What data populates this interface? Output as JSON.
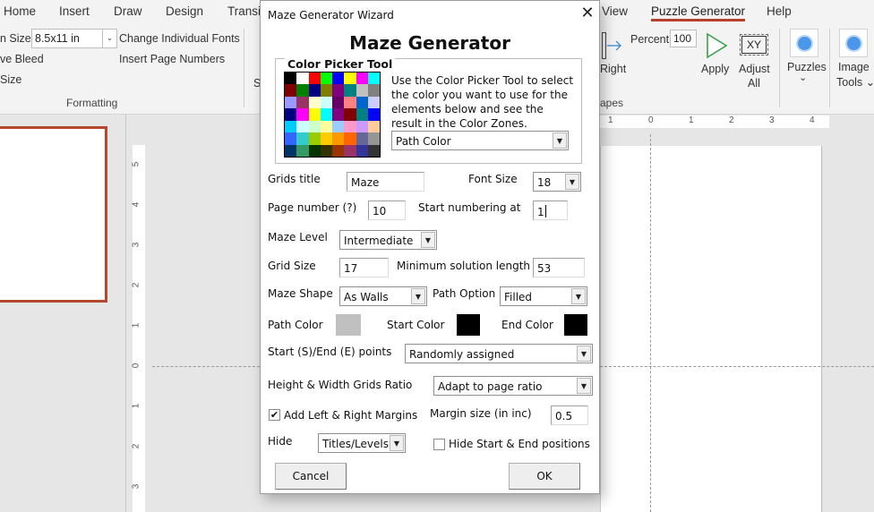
{
  "ribbon": {
    "tabs": [
      {
        "label": "Home"
      },
      {
        "label": "Insert"
      },
      {
        "label": "Draw"
      },
      {
        "label": "Design"
      },
      {
        "label": "Transit"
      },
      {
        "label": "View"
      },
      {
        "label": "Puzzle Generator",
        "active": true
      },
      {
        "label": "Help"
      }
    ],
    "formatting": {
      "size_label": "n Size",
      "size_value": "8.5x11 in",
      "bleed_label": "ve Bleed",
      "size2_label": "Size",
      "change_fonts": "Change Individual Fonts",
      "insert_page_numbers": "Insert Page Numbers",
      "group_label": "Formatting",
      "partial_group_letter": "S"
    },
    "shapes": {
      "right_label": "Right",
      "group_label": "apes",
      "percent_label": "Percent",
      "percent_value": "100",
      "apply_label": "Apply",
      "adjust_label_1": "Adjust",
      "adjust_label_2": "All",
      "xy_icon_text": "XY"
    },
    "puzzles": {
      "label": "Puzzles",
      "chevron": "⌄"
    },
    "image_tools": {
      "label_1": "Image",
      "label_2": "Tools ⌄"
    },
    "accent_color": "#b5412c"
  },
  "rulers": {
    "horizontal": [
      "1",
      "0",
      "1",
      "2",
      "3",
      "4"
    ],
    "vertical": [
      "5",
      "4",
      "3",
      "2",
      "1",
      "0",
      "1",
      "2",
      "3"
    ]
  },
  "dialog": {
    "window_title": "Maze Generator Wizard",
    "heading": "Maze Generator",
    "color_picker": {
      "legend": "Color Picker Tool",
      "help_text": "Use the Color Picker Tool to select the color you want to use for the elements below and see the result in the Color Zones.",
      "target_value": "Path Color",
      "palette": [
        "#000000",
        "#ffffff",
        "#ff0000",
        "#00ff00",
        "#0000ff",
        "#ffff00",
        "#ff00ff",
        "#00ffff",
        "#800000",
        "#008000",
        "#000080",
        "#808000",
        "#800080",
        "#008080",
        "#c0c0c0",
        "#808080",
        "#9999ff",
        "#993366",
        "#ffffcc",
        "#ccffff",
        "#660066",
        "#ff8080",
        "#0066cc",
        "#ccccff",
        "#000080",
        "#ff00ff",
        "#ffff00",
        "#00ffff",
        "#800080",
        "#800000",
        "#008080",
        "#0000ff",
        "#00ccff",
        "#ccffff",
        "#ccffcc",
        "#ffff99",
        "#99ccff",
        "#ff99cc",
        "#cc99ff",
        "#ffcc99",
        "#3366ff",
        "#33cccc",
        "#99cc00",
        "#ffcc00",
        "#ff9900",
        "#ff6600",
        "#666699",
        "#969696",
        "#003366",
        "#339966",
        "#003300",
        "#333300",
        "#993300",
        "#993366",
        "#333399",
        "#333333"
      ]
    },
    "fields": {
      "grids_title_label": "Grids title",
      "grids_title_value": "Maze",
      "font_size_label": "Font Size",
      "font_size_value": "18",
      "page_number_label": "Page number (?)",
      "page_number_value": "10",
      "start_numbering_label": "Start numbering at",
      "start_numbering_value": "1",
      "maze_level_label": "Maze Level",
      "maze_level_value": "Intermediate",
      "grid_size_label": "Grid Size",
      "grid_size_value": "17",
      "min_solution_label": "Minimum solution length",
      "min_solution_value": "53",
      "maze_shape_label": "Maze Shape",
      "maze_shape_value": "As Walls",
      "path_option_label": "Path Option",
      "path_option_value": "Filled",
      "path_color_label": "Path Color",
      "path_color": "#c0c0c0",
      "start_color_label": "Start Color",
      "start_color": "#000000",
      "end_color_label": "End Color",
      "end_color": "#000000",
      "se_points_label": "Start (S)/End (E) points",
      "se_points_value": "Randomly assigned",
      "ratio_label": "Height & Width Grids Ratio",
      "ratio_value": "Adapt to page ratio",
      "margins_label": "Add Left & Right Margins",
      "margins_checked": true,
      "margin_size_label": "Margin size (in inc)",
      "margin_size_value": "0.5",
      "hide_label": "Hide",
      "hide_value": "Titles/Levels",
      "hide_se_label": "Hide Start & End positions",
      "hide_se_checked": false
    },
    "buttons": {
      "cancel": "Cancel",
      "ok": "OK"
    }
  }
}
